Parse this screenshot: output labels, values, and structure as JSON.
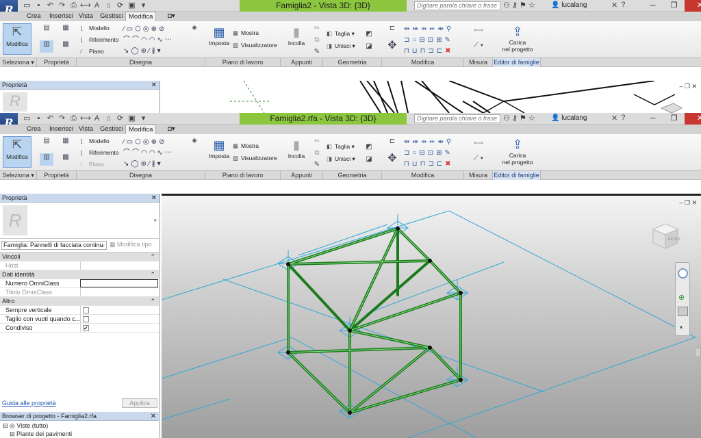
{
  "colors": {
    "accent": "#8cc63f",
    "selection": "#b9d4f0",
    "model": "#1f8a1f",
    "refplane": "#2fa9d6",
    "titleActive": "#8cc63f"
  },
  "back": {
    "title": "Famiglia2 - Vista 3D: {3D}",
    "search_placeholder": "Digitare parola chiave o frase",
    "user": "lucalang",
    "properties_title": "Proprietà"
  },
  "front": {
    "title": "Famiglia2.rfa - Vista 3D: {3D}",
    "search_placeholder": "Digitare parola chiave o frase",
    "user": "lucalang"
  },
  "tabs": [
    "Crea",
    "Inserisci",
    "Vista",
    "Gestisci",
    "Modifica"
  ],
  "ribbon": {
    "modifica": "Modifica",
    "modello": "Modello",
    "riferimento": "Riferimento",
    "piano": "Piano",
    "imposta": "Imposta",
    "mostra": "Mostra",
    "visualizzatore": "Visualizzatore",
    "incolla": "Incolla",
    "taglia": "Taglia",
    "unisci": "Unisci",
    "carica1": "Carica",
    "carica2": "nel progetto"
  },
  "panels": [
    "Seleziona",
    "Proprietà",
    "Disegna",
    "Piano di lavoro",
    "Appunti",
    "Geometria",
    "Modifica",
    "Misura",
    "Editor di famiglie"
  ],
  "properties": {
    "title": "Proprietà",
    "type_selector": "Famiglia: Pannelli di facciata continu",
    "edit_type": "Modifica tipo",
    "groups": {
      "vincoli": "Vincoli",
      "dati": "Dati identità",
      "altro": "Altro"
    },
    "host": "Host",
    "numero": "Numero OmniClass",
    "titolo": "Titolo OmniClass",
    "sempre": "Sempre verticale",
    "taglio": "Taglio con vuoti quando c...",
    "condiviso": "Condiviso",
    "help_link": "Guida alle proprietà",
    "apply": "Applica"
  },
  "browser": {
    "title": "Browser di progetto - Famiglia2.rfa",
    "views": "Viste (tutto)",
    "floor": "Piante dei pavimenti"
  },
  "viewcube": {
    "label": "RETRO"
  }
}
